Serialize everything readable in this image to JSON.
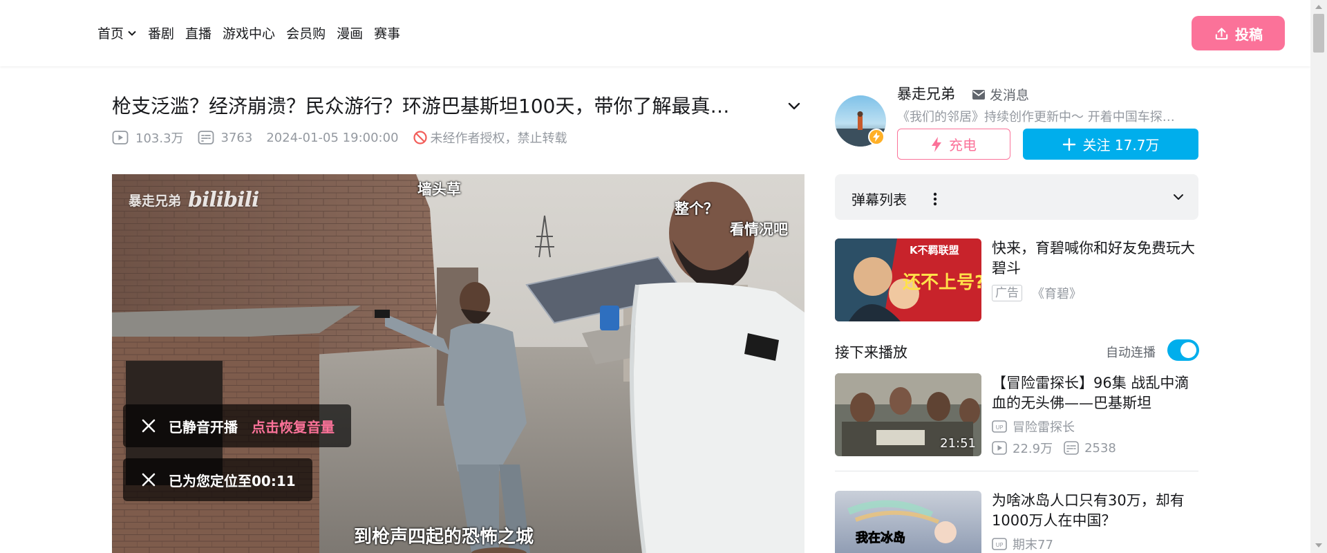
{
  "nav": {
    "items": [
      "首页",
      "番剧",
      "直播",
      "游戏中心",
      "会员购",
      "漫画",
      "赛事"
    ],
    "upload_label": "投稿"
  },
  "video": {
    "title": "枪支泛滥？经济崩溃？民众游行？环游巴基斯坦100天，带你了解最真…",
    "views": "103.3万",
    "danmaku_count": "3763",
    "publish_time": "2024-01-05 19:00:00",
    "copyright_notice": "未经作者授权，禁止转载"
  },
  "player": {
    "watermark_name": "暴走兄弟",
    "watermark_logo": "bilibili",
    "subtitles": {
      "top": "墙头草",
      "right1": "整个？",
      "right2": "看情况吧",
      "bottom": "到枪声四起的恐怖之城"
    },
    "toast_muted": "已静音开播",
    "toast_restore": "点击恢复音量",
    "toast_seek": "已为您定位至00:11"
  },
  "uploader": {
    "name": "暴走兄弟",
    "message_label": "发消息",
    "description": "《我们的邻居》持续创作更新中～ 开着中国车探…",
    "charge_label": "充电",
    "follow_label": "关注 17.7万"
  },
  "danmaku_list": {
    "label": "弹幕列表"
  },
  "ad": {
    "title": "快来，育碧喊你和好友免费玩大碧斗",
    "tag": "广告",
    "source": "《育碧》",
    "thumb_brand": "K不羁联盟",
    "thumb_slogan": "还不上号?"
  },
  "up_next": {
    "label": "接下来播放",
    "autoplay_label": "自动连播",
    "autoplay_on": true
  },
  "recommendations": [
    {
      "title": "【冒险雷探长】96集 战乱中滴血的无头佛——巴基斯坦",
      "up_name": "冒险雷探长",
      "views": "22.9万",
      "danmaku": "2538",
      "duration": "21:51"
    },
    {
      "title": "为啥冰岛人口只有30万，却有1000万人在中国？",
      "up_name": "期末77",
      "thumb_text": "我在冰岛"
    }
  ],
  "colors": {
    "pink": "#fb7299",
    "blue": "#00aeec",
    "gray_text": "#9499a0"
  }
}
